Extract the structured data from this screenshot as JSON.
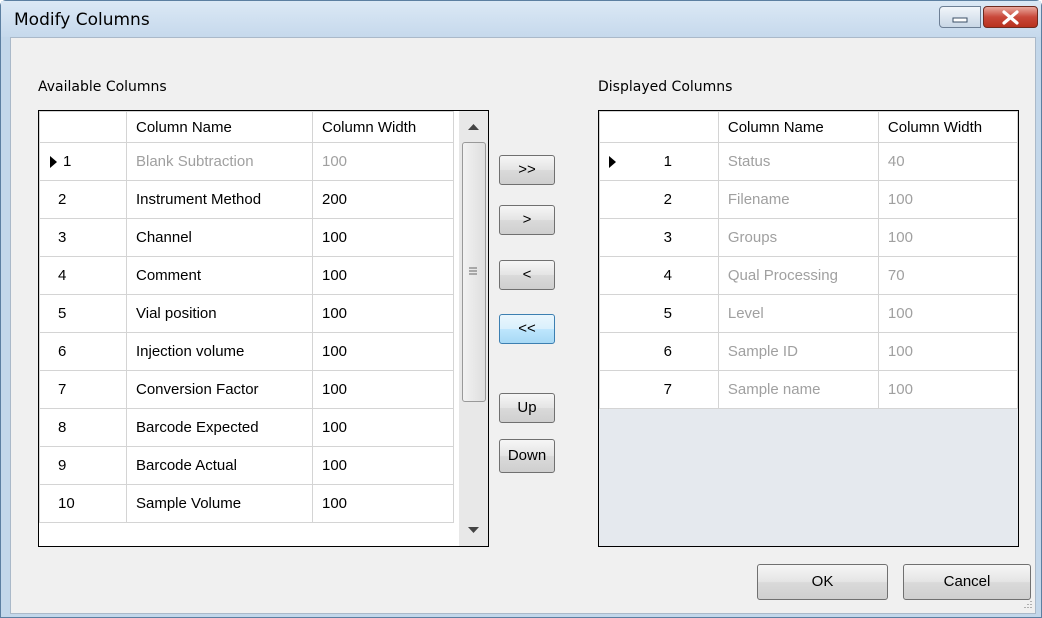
{
  "window": {
    "title": "Modify Columns"
  },
  "available": {
    "label": "Available Columns",
    "headers": {
      "name": "Column Name",
      "width": "Column Width"
    },
    "rows": [
      {
        "num": "1",
        "name": "Blank Subtraction",
        "width": "100",
        "disabled": true
      },
      {
        "num": "2",
        "name": "Instrument Method",
        "width": "200",
        "disabled": false
      },
      {
        "num": "3",
        "name": "Channel",
        "width": "100",
        "disabled": false
      },
      {
        "num": "4",
        "name": "Comment",
        "width": "100",
        "disabled": false
      },
      {
        "num": "5",
        "name": "Vial position",
        "width": "100",
        "disabled": false
      },
      {
        "num": "6",
        "name": "Injection volume",
        "width": "100",
        "disabled": false
      },
      {
        "num": "7",
        "name": "Conversion Factor",
        "width": "100",
        "disabled": false
      },
      {
        "num": "8",
        "name": "Barcode Expected",
        "width": "100",
        "disabled": false
      },
      {
        "num": "9",
        "name": "Barcode Actual",
        "width": "100",
        "disabled": false
      },
      {
        "num": "10",
        "name": "Sample Volume",
        "width": "100",
        "disabled": false
      }
    ]
  },
  "displayed": {
    "label": "Displayed Columns",
    "headers": {
      "name": "Column Name",
      "width": "Column Width"
    },
    "rows": [
      {
        "num": "1",
        "name": "Status",
        "width": "40"
      },
      {
        "num": "2",
        "name": "Filename",
        "width": "100"
      },
      {
        "num": "3",
        "name": "Groups",
        "width": "100"
      },
      {
        "num": "4",
        "name": "Qual Processing",
        "width": "70"
      },
      {
        "num": "5",
        "name": "Level",
        "width": "100"
      },
      {
        "num": "6",
        "name": "Sample ID",
        "width": "100"
      },
      {
        "num": "7",
        "name": "Sample name",
        "width": "100"
      }
    ]
  },
  "buttons": {
    "add_all": ">>",
    "add": ">",
    "remove": "<",
    "remove_all": "<<",
    "up": "Up",
    "down": "Down",
    "ok": "OK",
    "cancel": "Cancel"
  },
  "icons": {
    "row_indicator": "current-row-triangle-icon",
    "minimize": "minimize-icon",
    "maximize": "maximize-icon",
    "close": "close-icon"
  },
  "colors": {
    "close_button": "#c9483a",
    "title_bar": "#c6d9ec",
    "disabled_text": "#a0a0a0"
  }
}
